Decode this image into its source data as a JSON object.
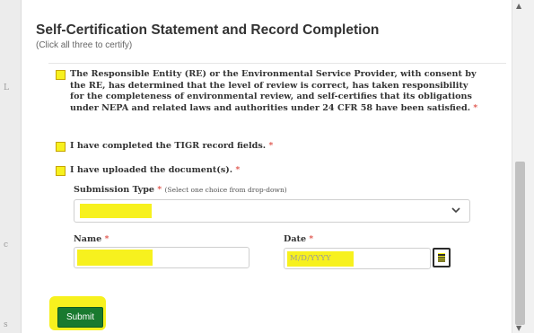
{
  "modal": {
    "title": "Self-Certification Statement and Record Completion",
    "subtitle": "(Click all three to certify)",
    "required_marker": "*"
  },
  "certifications": [
    {
      "text": "The Responsible Entity (RE) or the Environmental Service Provider, with consent by the RE, has determined that the level of review is correct, has taken responsibility for the completeness of environmental review, and self-certifies that its obligations under NEPA and related laws and authorities under 24 CFR 58 have been satisfied.",
      "checked": false
    },
    {
      "text": "I have completed the TIGR record fields.",
      "checked": false
    },
    {
      "text": "I have uploaded the document(s).",
      "checked": false
    }
  ],
  "form": {
    "submission_type": {
      "label": "Submission Type",
      "hint": "(Select one choice from drop-down)",
      "value": ""
    },
    "name": {
      "label": "Name",
      "value": ""
    },
    "date": {
      "label": "Date",
      "placeholder": "M/D/YYYY",
      "value": ""
    }
  },
  "actions": {
    "submit_label": "Submit"
  },
  "colors": {
    "highlight": "#f7f11e",
    "submit_bg": "#197a2f",
    "required": "#d9342b",
    "title": "#333333"
  },
  "icons": {
    "dropdown": "chevron-down-icon",
    "date_picker": "calendar-icon"
  }
}
